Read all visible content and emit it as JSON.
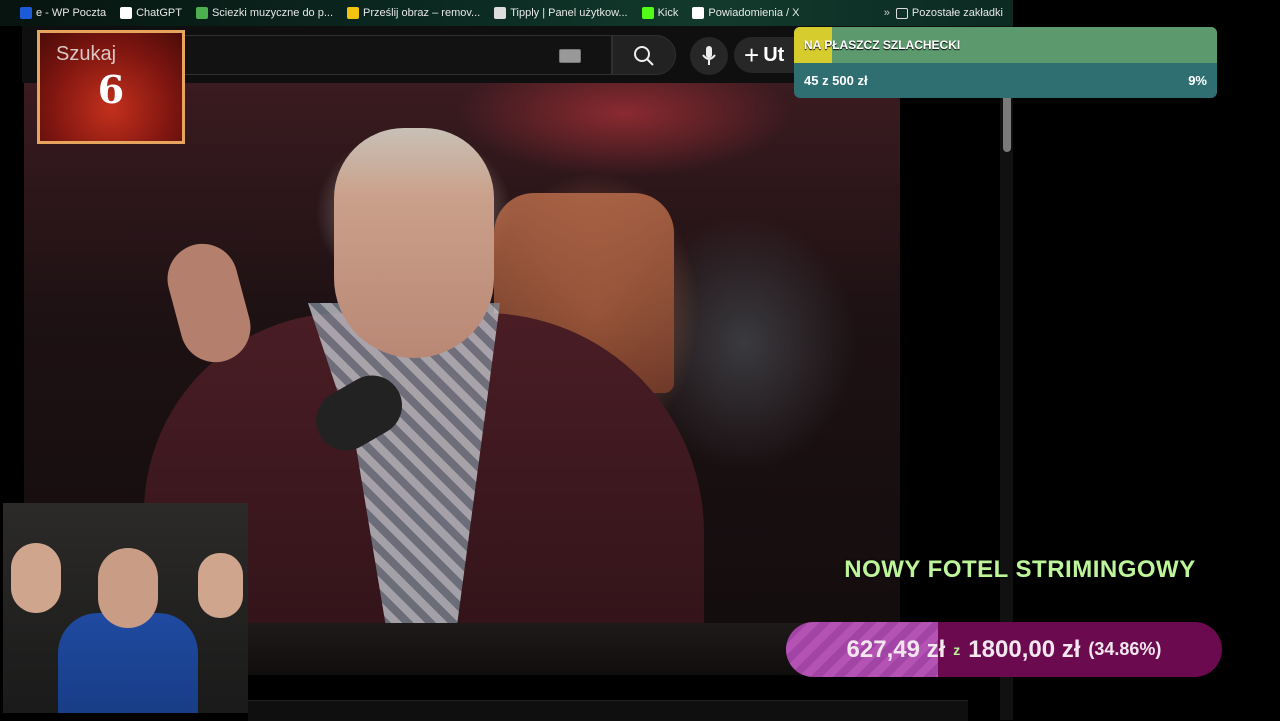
{
  "bookmarks": {
    "items": [
      {
        "label": "e - WP Poczta",
        "icon_color": "#1b5ad8",
        "icon": "wp-icon"
      },
      {
        "label": "ChatGPT",
        "icon_color": "#ffffff",
        "icon": "chatgpt-icon"
      },
      {
        "label": "Sciezki muzyczne do p...",
        "icon_color": "#4caf50",
        "icon": "image-icon"
      },
      {
        "label": "Prześlij obraz – remov...",
        "icon_color": "#f2c40f",
        "icon": "envelope-icon"
      },
      {
        "label": "Tipply | Panel użytkow...",
        "icon_color": "#dddddd",
        "icon": "tipply-icon"
      },
      {
        "label": "Kick",
        "icon_color": "#53fc18",
        "icon": "kick-icon"
      },
      {
        "label": "Powiadomienia / X",
        "icon_color": "#ffffff",
        "icon": "x-icon"
      }
    ],
    "overflow": "»",
    "other_folder": "Pozostałe zakładki"
  },
  "youtube": {
    "create_label": "Ut",
    "create_icon": "plus-icon"
  },
  "search_counter": {
    "label": "Szukaj",
    "value": "6"
  },
  "goal_widget": {
    "title": "NA PŁASZCZ SZLACHECKI",
    "amount": "45  z  500  zł",
    "percent_label": "9%",
    "progress": 0.09,
    "colors": {
      "fill": "#d7cc2e",
      "track": "#5c9a6e",
      "panel": "#2f6f72"
    }
  },
  "donation": {
    "title": "NOWY FOTEL STRIMINGOWY",
    "current": "627,49 zł",
    "separator": "z",
    "goal": "1800,00 zł",
    "percent_label": "(34.86%)",
    "progress": 0.3486,
    "colors": {
      "title": "#bdf59a",
      "fill": "#b553b5",
      "track": "#6b0a4e"
    }
  }
}
